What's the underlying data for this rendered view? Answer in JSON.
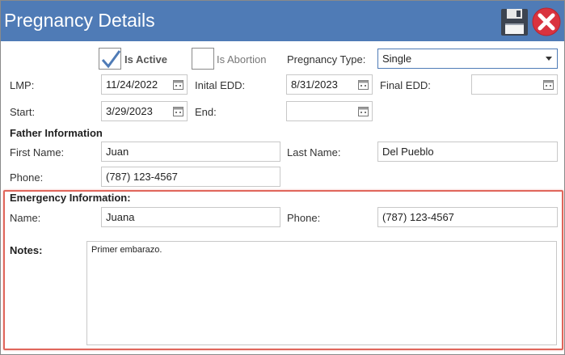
{
  "window": {
    "title": "Pregnancy Details"
  },
  "toolbar": {
    "save_icon": "floppy-disk-icon",
    "close_icon": "close-x-icon"
  },
  "flags": {
    "is_active_label": "Is Active",
    "is_active_checked": true,
    "is_abortion_label": "Is Abortion",
    "is_abortion_checked": false
  },
  "pregnancy_type": {
    "label": "Pregnancy Type:",
    "value": "Single"
  },
  "dates": {
    "lmp_label": "LMP:",
    "lmp_value": "11/24/2022",
    "inital_edd_label": "Inital EDD:",
    "inital_edd_value": "8/31/2023",
    "final_edd_label": "Final EDD:",
    "final_edd_value": "",
    "start_label": "Start:",
    "start_value": "3/29/2023",
    "end_label": "End:",
    "end_value": ""
  },
  "father": {
    "heading": "Father Information",
    "first_name_label": "First Name:",
    "first_name_value": "Juan",
    "last_name_label": "Last Name:",
    "last_name_value": "Del Pueblo",
    "phone_label": "Phone:",
    "phone_value": "(787) 123-4567"
  },
  "emergency": {
    "heading": "Emergency Information:",
    "name_label": "Name:",
    "name_value": "Juana",
    "phone_label": "Phone:",
    "phone_value": "(787) 123-4567"
  },
  "notes": {
    "label": "Notes:",
    "value": "Primer embarazo."
  },
  "colors": {
    "titlebar": "#4f7bb6",
    "highlight": "#e0665b",
    "checkmark": "#4f7bb6"
  }
}
